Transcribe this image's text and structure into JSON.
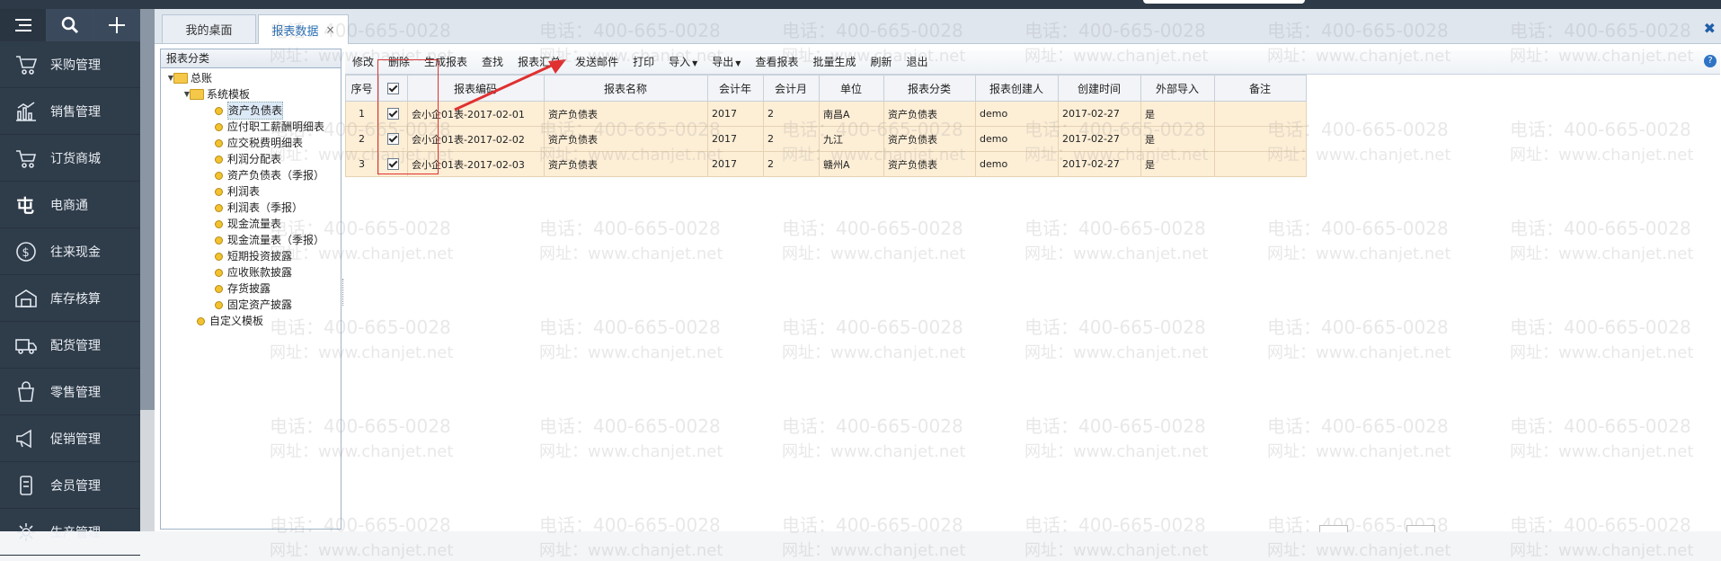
{
  "sidebar": {
    "items": [
      {
        "label": "采购管理",
        "icon": "cart-icon"
      },
      {
        "label": "销售管理",
        "icon": "bar-chart-icon"
      },
      {
        "label": "订货商城",
        "icon": "shopping-cart-icon"
      },
      {
        "label": "电商通",
        "icon": "ecommerce-icon"
      },
      {
        "label": "往来现金",
        "icon": "dollar-circle-icon"
      },
      {
        "label": "库存核算",
        "icon": "warehouse-icon"
      },
      {
        "label": "配货管理",
        "icon": "truck-icon"
      },
      {
        "label": "零售管理",
        "icon": "retail-bag-icon"
      },
      {
        "label": "促销管理",
        "icon": "megaphone-icon"
      },
      {
        "label": "会员管理",
        "icon": "member-card-icon"
      },
      {
        "label": "生产管理",
        "icon": "gear-icon"
      }
    ]
  },
  "tabs": [
    {
      "label": "我的桌面"
    },
    {
      "label": "报表数据",
      "close": "×"
    }
  ],
  "left_panel": {
    "title": "报表分类",
    "tree": {
      "root": "总账",
      "system": "系统模板",
      "leaves": [
        "资产负债表",
        "应付职工薪酬明细表",
        "应交税费明细表",
        "利润分配表",
        "资产负债表（季报）",
        "利润表",
        "利润表（季报）",
        "现金流量表",
        "现金流量表（季报）",
        "短期投资披露",
        "应收账款披露",
        "存货披露",
        "固定资产披露"
      ],
      "custom": "自定义模板"
    }
  },
  "toolbar": {
    "buttons": [
      "修改",
      "删除",
      "生成报表",
      "查找",
      "报表汇总",
      "发送邮件",
      "打印",
      "导入",
      "导出",
      "查看报表",
      "批量生成",
      "刷新",
      "退出"
    ]
  },
  "grid": {
    "headers": [
      "序号",
      "",
      "报表编码",
      "报表名称",
      "会计年",
      "会计月",
      "单位",
      "报表分类",
      "报表创建人",
      "创建时间",
      "外部导入",
      "备注"
    ],
    "rows": [
      [
        "1",
        "会小企01表-2017-02-01",
        "资产负债表",
        "2017",
        "2",
        "南昌A",
        "资产负债表",
        "demo",
        "2017-02-27",
        "是",
        ""
      ],
      [
        "2",
        "会小企01表-2017-02-02",
        "资产负债表",
        "2017",
        "2",
        "九江",
        "资产负债表",
        "demo",
        "2017-02-27",
        "是",
        ""
      ],
      [
        "3",
        "会小企01表-2017-02-03",
        "资产负债表",
        "2017",
        "2",
        "赣州A",
        "资产负债表",
        "demo",
        "2017-02-27",
        "是",
        ""
      ]
    ]
  },
  "watermark": {
    "phone": "电话：400-665-0028",
    "site": "网址：www.chanjet.net"
  },
  "colors": {
    "sidebar_bg": "#2f3c4a",
    "row_bg": "#fdeed6",
    "annotation_red": "#e03030",
    "active_tab": "#2a6fb5"
  }
}
